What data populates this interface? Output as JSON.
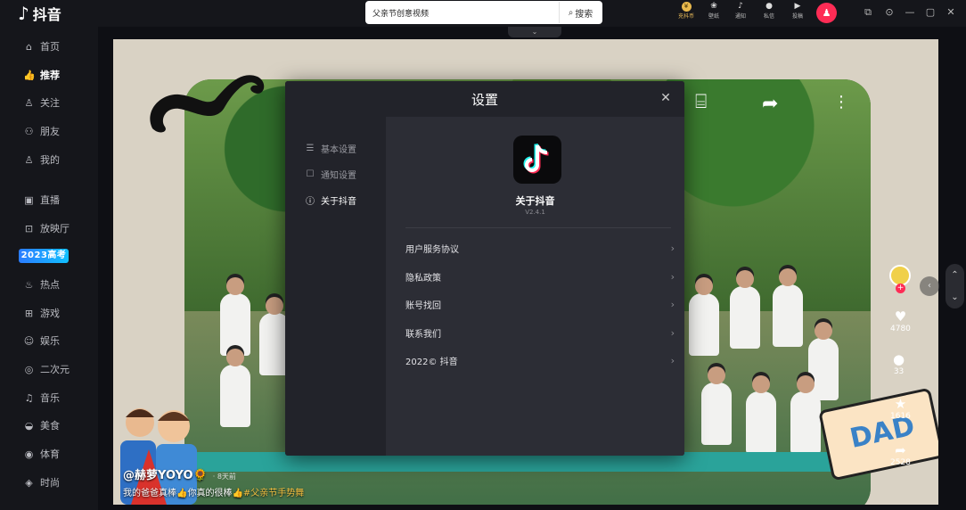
{
  "app": {
    "logo_text": "抖音"
  },
  "sidebar": {
    "items": [
      {
        "label": "首页",
        "icon": "home-icon",
        "glyph": "⌂"
      },
      {
        "label": "推荐",
        "icon": "thumb-up-icon",
        "glyph": "👍"
      },
      {
        "label": "关注",
        "icon": "person-plus-icon",
        "glyph": "♙"
      },
      {
        "label": "朋友",
        "icon": "friends-icon",
        "glyph": "⚇"
      },
      {
        "label": "我的",
        "icon": "user-icon",
        "glyph": "♙"
      },
      {
        "label": "直播",
        "icon": "live-icon",
        "glyph": "▣"
      },
      {
        "label": "放映厅",
        "icon": "tv-icon",
        "glyph": "⊡"
      },
      {
        "label": "热点",
        "icon": "flame-icon",
        "glyph": "♨"
      },
      {
        "label": "游戏",
        "icon": "gamepad-icon",
        "glyph": "⊞"
      },
      {
        "label": "娱乐",
        "icon": "smile-icon",
        "glyph": "☺"
      },
      {
        "label": "二次元",
        "icon": "anime-icon",
        "glyph": "◎"
      },
      {
        "label": "音乐",
        "icon": "music-icon",
        "glyph": "♫"
      },
      {
        "label": "美食",
        "icon": "food-icon",
        "glyph": "◒"
      },
      {
        "label": "体育",
        "icon": "sports-icon",
        "glyph": "◉"
      },
      {
        "label": "时尚",
        "icon": "fashion-icon",
        "glyph": "◈"
      }
    ],
    "active_index": 1,
    "gaokao_badge": "2023高考"
  },
  "search": {
    "value": "父亲节创意视频",
    "button_label": "搜索"
  },
  "topbar": {
    "icons": [
      {
        "label": "充抖币",
        "icon": "coin-icon",
        "glyph": "¥"
      },
      {
        "label": "壁纸",
        "icon": "wallpaper-icon",
        "glyph": "❀"
      },
      {
        "label": "通知",
        "icon": "bell-icon",
        "glyph": "♪"
      },
      {
        "label": "私信",
        "icon": "message-icon",
        "glyph": "●"
      },
      {
        "label": "投稿",
        "icon": "upload-icon",
        "glyph": "▶"
      }
    ]
  },
  "video": {
    "author": "@赫萝YOYO🌻",
    "time": "· 8天前",
    "desc": "我的爸爸真棒👍你真的很棒👍",
    "tag": "#父亲节手势舞",
    "likes": "4780",
    "comments": "33",
    "favorites": "1616",
    "shares": "2528"
  },
  "dialog": {
    "title": "设置",
    "tabs": [
      {
        "label": "基本设置",
        "icon": "sliders-icon",
        "glyph": "☰"
      },
      {
        "label": "通知设置",
        "icon": "notify-icon",
        "glyph": "☐"
      },
      {
        "label": "关于抖音",
        "icon": "info-icon",
        "glyph": "ⓘ"
      }
    ],
    "active_tab": 2,
    "app_name": "关于抖音",
    "app_version": "V2.4.1",
    "rows": [
      "用户服务协议",
      "隐私政策",
      "账号找回",
      "联系我们",
      "2022© 抖音"
    ]
  },
  "colors": {
    "accent": "#fe2c55",
    "gold": "#e8b84d",
    "dialog_bg": "#2c2d35",
    "sidebar_bg": "#15161b"
  }
}
